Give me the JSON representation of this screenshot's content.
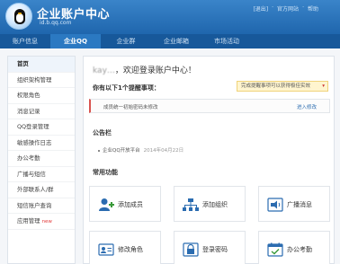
{
  "header": {
    "title": "企业账户中心",
    "url": "id.b.qq.com",
    "top_links": [
      "[退出]",
      "·",
      "官方网站",
      "·",
      "帮助"
    ]
  },
  "nav": {
    "items": [
      {
        "label": "账户信息",
        "active": false
      },
      {
        "label": "企业QQ",
        "active": true
      },
      {
        "label": "企业群",
        "active": false
      },
      {
        "label": "企业邮箱",
        "active": false
      },
      {
        "label": "市场活动",
        "active": false
      }
    ]
  },
  "sidebar": {
    "items": [
      {
        "label": "首页",
        "active": true,
        "new": false
      },
      {
        "label": "组织架构管理",
        "active": false,
        "new": false
      },
      {
        "label": "权限角色",
        "active": false,
        "new": false
      },
      {
        "label": "消息记录",
        "active": false,
        "new": false
      },
      {
        "label": "QQ登录管理",
        "active": false,
        "new": false
      },
      {
        "label": "敏感操作日志",
        "active": false,
        "new": false
      },
      {
        "label": "办公考勤",
        "active": false,
        "new": false
      },
      {
        "label": "广播与短信",
        "active": false,
        "new": false
      },
      {
        "label": "外部联系人/群",
        "active": false,
        "new": false
      },
      {
        "label": "短信账户查询",
        "active": false,
        "new": false
      },
      {
        "label": "应用管理",
        "active": false,
        "new": true
      }
    ],
    "new_label": "new"
  },
  "main": {
    "welcome_name": "kay…",
    "welcome_text": "，欢迎登录账户中心！",
    "todo_label": "你有以下1个提醒事项：",
    "todo_badge": "完成提醒事项可以获得极佳实效",
    "notice_text": "成员统一初始密码未修改",
    "notice_link": "进入修改",
    "announcement_title": "公告栏",
    "announcement": {
      "text": "企业QQ开放平台",
      "date": "2014年04月22日"
    },
    "functions_title": "常用功能",
    "functions": [
      {
        "label": "添加成员",
        "icon": "add-member-icon"
      },
      {
        "label": "添加组织",
        "icon": "add-org-icon"
      },
      {
        "label": "广播消息",
        "icon": "broadcast-icon"
      },
      {
        "label": "修改角色",
        "icon": "edit-role-icon"
      },
      {
        "label": "登录密码",
        "icon": "login-password-icon"
      },
      {
        "label": "办公考勤",
        "icon": "attendance-icon"
      }
    ]
  },
  "colors": {
    "header_blue": "#1f66ad",
    "nav_blue": "#17589a",
    "accent_red": "#d9534f",
    "icon_blue": "#2b6cb0"
  }
}
